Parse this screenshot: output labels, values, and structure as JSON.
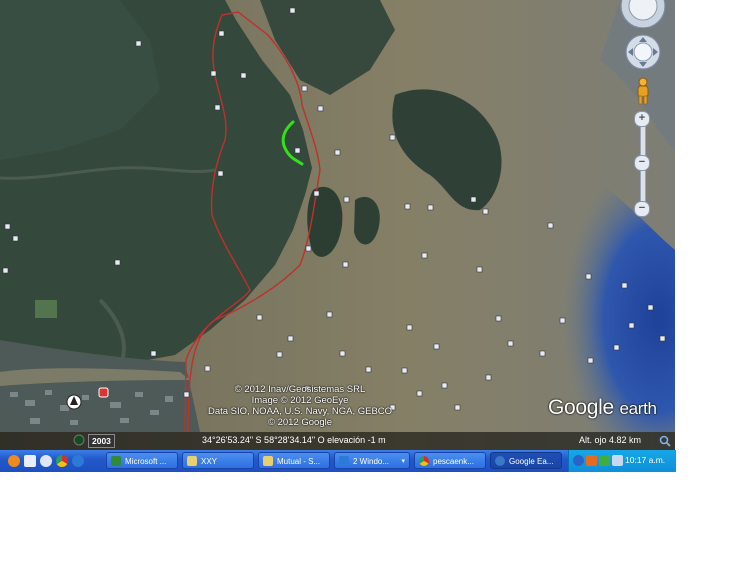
{
  "map": {
    "copyright": [
      "© 2012 Inav/Geosistemas SRL",
      "Image © 2012 GeoEye",
      "Data SIO, NOAA, U.S. Navy, NGA, GEBCO",
      "© 2012 Google"
    ],
    "brand_google": "Google",
    "brand_earth": "earth",
    "imagery_date": "2003",
    "coordinates": "34°26'53.24\" S  58°28'34.14\" O  elevación    -1 m",
    "eye_altitude": "Alt. ojo    4.82 km"
  },
  "colors": {
    "track": "#c0302c",
    "highlight": "#33e01a",
    "water": "#7e7a63",
    "land": "#33473c"
  },
  "taskbar": {
    "items": [
      {
        "label": "Microsoft ...",
        "icon": "excel-icon",
        "active": false
      },
      {
        "label": "XXY",
        "icon": "folder-icon",
        "active": false
      },
      {
        "label": "Mutual - S...",
        "icon": "folder-icon",
        "active": false
      },
      {
        "label": "2 Windo...",
        "icon": "ie-icon",
        "active": false
      },
      {
        "label": "pescaenk...",
        "icon": "chrome-icon",
        "active": false
      },
      {
        "label": "Google Ea...",
        "icon": "google-earth-icon",
        "active": true
      }
    ],
    "clock": "10:17 a.m."
  },
  "zoom": {
    "plus": "+",
    "minus": "−",
    "min": "−"
  }
}
